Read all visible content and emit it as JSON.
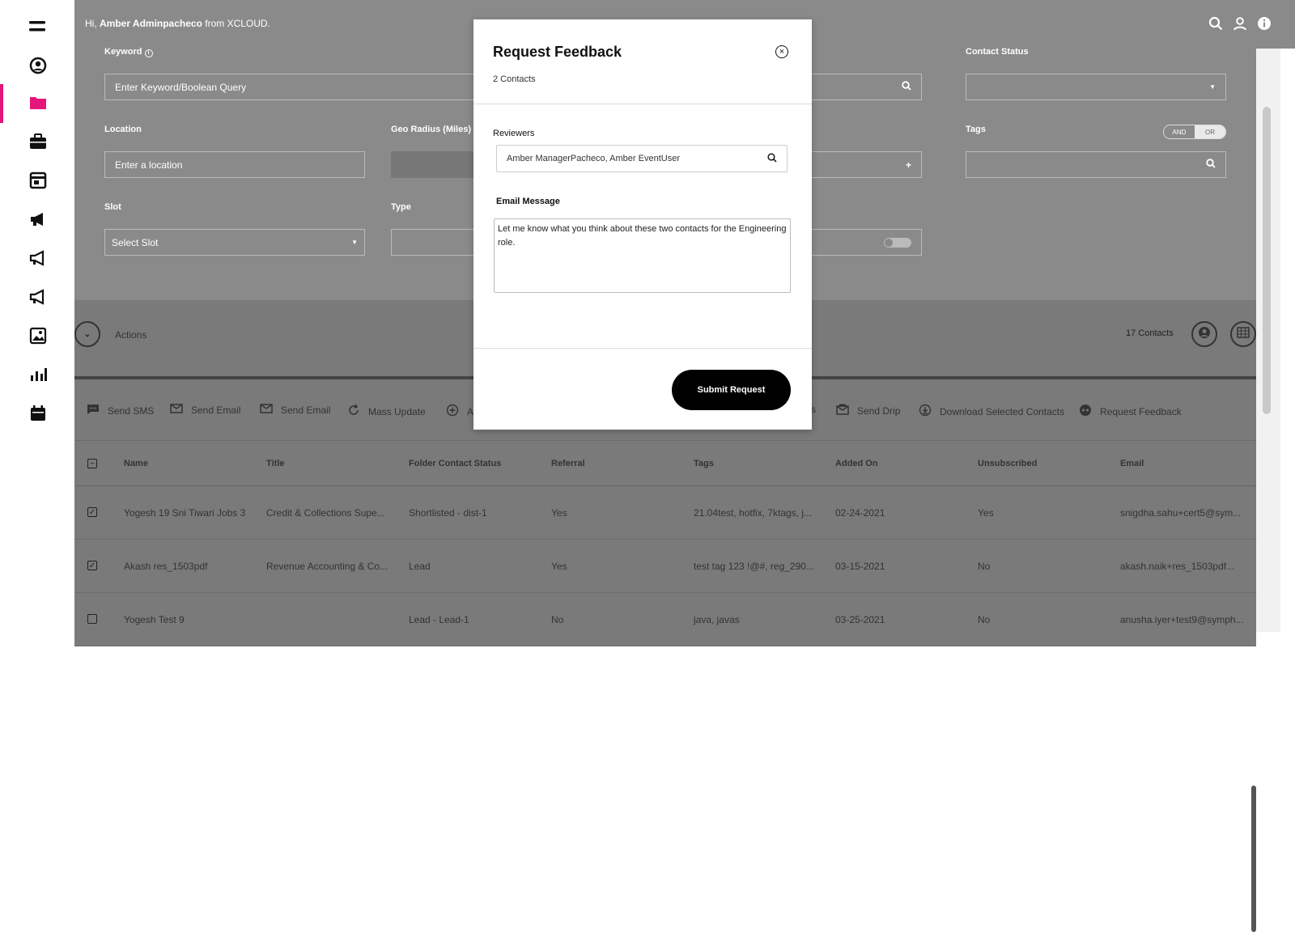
{
  "greeting": {
    "prefix": "Hi, ",
    "user": "Amber Adminpacheco",
    "suffix": " from XCLOUD."
  },
  "filters": {
    "keyword_label": "Keyword",
    "keyword_placeholder": "Enter Keyword/Boolean Query",
    "contact_status_label": "Contact Status",
    "location_label": "Location",
    "location_placeholder": "Enter a location",
    "geo_radius_label": "Geo Radius (Miles)",
    "tags_label": "Tags",
    "and_label": "AND",
    "or_label": "OR",
    "slot_label": "Slot",
    "slot_value": "Select Slot",
    "type_label": "Type"
  },
  "actions_bar": {
    "actions_label": "Actions",
    "contacts_count": "17 Contacts"
  },
  "action_buttons": [
    {
      "label": "Send SMS",
      "icon": "sms-icon"
    },
    {
      "label": "Send Email",
      "icon": "email-icon"
    },
    {
      "label": "Send Email",
      "icon": "email-icon"
    },
    {
      "label": "Mass Update",
      "icon": "refresh-icon"
    },
    {
      "label": "A",
      "icon": "add-circle-icon"
    },
    {
      "label": "s",
      "icon": ""
    },
    {
      "label": "Send Drip",
      "icon": "drip-icon"
    },
    {
      "label": "Download Selected Contacts",
      "icon": "download-icon"
    },
    {
      "label": "Request Feedback",
      "icon": "feedback-icon"
    }
  ],
  "table": {
    "headers": [
      "Name",
      "Title",
      "Folder Contact Status",
      "Referral",
      "Tags",
      "Added On",
      "Unsubscribed",
      "Email"
    ],
    "rows": [
      {
        "checked": true,
        "cells": [
          "Yogesh 19 Sni Tiwari Jobs 3",
          "Credit & Collections Supe...",
          "Shortlisted - dist-1",
          "Yes",
          "21.04test, hotfix, 7ktags, j...",
          "02-24-2021",
          "Yes",
          "snigdha.sahu+cert5@sym..."
        ]
      },
      {
        "checked": true,
        "cells": [
          "Akash res_1503pdf",
          "Revenue Accounting & Co...",
          "Lead",
          "Yes",
          "test tag 123 !@#, reg_290...",
          "03-15-2021",
          "No",
          "akash.naik+res_1503pdf..."
        ]
      },
      {
        "checked": false,
        "cells": [
          "Yogesh Test 9",
          "",
          "Lead - Lead-1",
          "No",
          "java, javas",
          "03-25-2021",
          "No",
          "anusha.iyer+test9@symph..."
        ]
      }
    ]
  },
  "modal": {
    "title": "Request Feedback",
    "subtitle": "2 Contacts",
    "reviewers_label": "Reviewers",
    "reviewers_value": "Amber ManagerPacheco, Amber EventUser",
    "email_label": "Email Message",
    "email_text": "Let me know what you think about these two contacts for the Engineering role.",
    "submit_label": "Submit Request"
  },
  "colors": {
    "accent": "#e5157a",
    "overlay": "#8a8a8a"
  }
}
